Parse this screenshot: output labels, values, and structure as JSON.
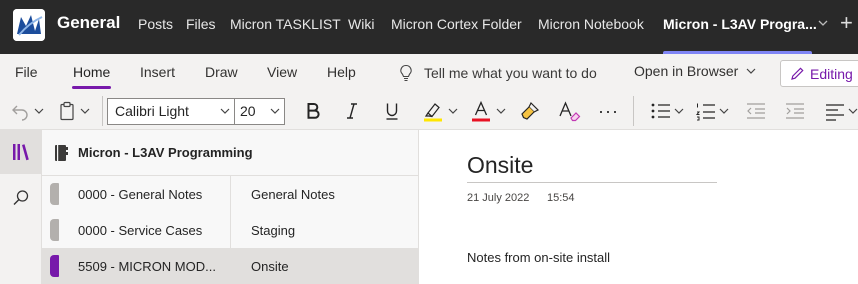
{
  "header": {
    "channel_title": "General",
    "tabs": [
      "Posts",
      "Files",
      "Micron TASKLIST",
      "Wiki",
      "Micron Cortex Folder",
      "Micron Notebook"
    ],
    "active_tab": "Micron - L3AV Progra...",
    "add_tab_label": "+"
  },
  "menu": {
    "items": [
      "File",
      "Home",
      "Insert",
      "Draw",
      "View",
      "Help"
    ],
    "active": "Home",
    "tell_me": "Tell me what you want to do",
    "open_in_browser": "Open in Browser",
    "editing": "Editing"
  },
  "ribbon": {
    "font_name": "Calibri Light",
    "font_size": "20",
    "highlight_color": "#ffe600",
    "font_color": "#e81123",
    "more_label": "···"
  },
  "notebook": {
    "title": "Micron - L3AV Programming",
    "sections": [
      {
        "label": "0000 - General Notes",
        "color": "#b3b0ad"
      },
      {
        "label": "0000 - Service Cases",
        "color": "#b3b0ad"
      },
      {
        "label": "5509 - MICRON MOD...",
        "color": "#7719aa"
      }
    ],
    "pages": [
      {
        "label": "General Notes"
      },
      {
        "label": "Staging"
      },
      {
        "label": "Onsite"
      }
    ]
  },
  "page": {
    "title": "Onsite",
    "date": "21 July 2022",
    "time": "15:54",
    "body": "Notes from on-site install"
  },
  "colors": {
    "accent": "#7719aa",
    "teams_bar": "#292929",
    "teams_tab_underline": "#7f85f5"
  }
}
